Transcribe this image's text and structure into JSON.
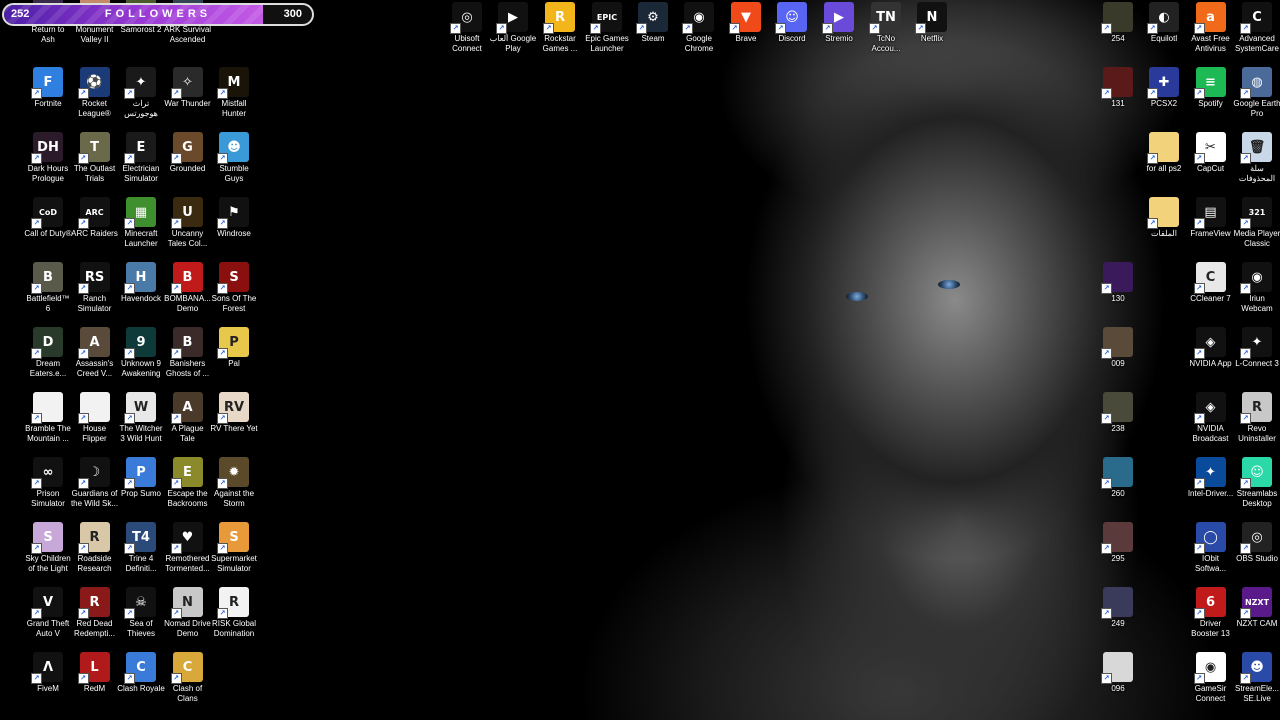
{
  "followers": {
    "current": "252",
    "goal": "300",
    "title": "FOLLOWERS",
    "progress_fraction": 0.84
  },
  "desktop": {
    "icons": [
      {
        "label": "Return to Ash",
        "col": 0,
        "row": 0,
        "color": "#3a2a4a",
        "glyph": "",
        "icon": "game-icon"
      },
      {
        "label": "Monument Valley II",
        "col": 1,
        "row": 0,
        "color": "#c48a6a",
        "glyph": "",
        "icon": "game-icon"
      },
      {
        "label": "Samorost 2",
        "col": 2,
        "row": 0,
        "color": "#4a5a2a",
        "glyph": "",
        "icon": "game-icon"
      },
      {
        "label": "ARK Survival Ascended",
        "col": 3,
        "row": 0,
        "color": "#334455",
        "glyph": "",
        "icon": "game-icon"
      },
      {
        "label": "Fortnite",
        "col": 0,
        "row": 1,
        "color": "#2f7fe0",
        "glyph": "F",
        "icon": "fortnite-icon"
      },
      {
        "label": "Rocket League®",
        "col": 1,
        "row": 1,
        "color": "#1b3a78",
        "glyph": "⚽",
        "icon": "rocket-league-icon"
      },
      {
        "label": "تراث هوجورتس",
        "col": 2,
        "row": 1,
        "color": "#1a1a1a",
        "glyph": "✦",
        "icon": "hogwarts-icon"
      },
      {
        "label": "War Thunder",
        "col": 3,
        "row": 1,
        "color": "#2a2a2a",
        "glyph": "✧",
        "icon": "war-thunder-icon"
      },
      {
        "label": "Mistfall Hunter",
        "col": 4,
        "row": 1,
        "color": "#1a1408",
        "glyph": "M",
        "icon": "game-icon"
      },
      {
        "label": "Dark Hours Prologue",
        "col": 0,
        "row": 2,
        "color": "#2a1a2a",
        "glyph": "DH",
        "icon": "game-icon"
      },
      {
        "label": "The Outlast Trials",
        "col": 1,
        "row": 2,
        "color": "#6a6a4a",
        "glyph": "T",
        "icon": "game-icon"
      },
      {
        "label": "Electrician Simulator",
        "col": 2,
        "row": 2,
        "color": "#1a1a1a",
        "glyph": "E",
        "icon": "game-icon"
      },
      {
        "label": "Grounded",
        "col": 3,
        "row": 2,
        "color": "#6a4a2a",
        "glyph": "G",
        "icon": "game-icon"
      },
      {
        "label": "Stumble Guys",
        "col": 4,
        "row": 2,
        "color": "#3a9ad8",
        "glyph": "☻",
        "icon": "game-icon"
      },
      {
        "label": "Call of Duty®",
        "col": 0,
        "row": 3,
        "color": "#111",
        "glyph": "CoD",
        "icon": "game-icon"
      },
      {
        "label": "ARC Raiders",
        "col": 1,
        "row": 3,
        "color": "#111",
        "glyph": "ARC",
        "icon": "game-icon"
      },
      {
        "label": "Minecraft Launcher",
        "col": 2,
        "row": 3,
        "color": "#3f8f2f",
        "glyph": "▦",
        "icon": "minecraft-icon"
      },
      {
        "label": "Uncanny Tales Col...",
        "col": 3,
        "row": 3,
        "color": "#3a2a10",
        "glyph": "U",
        "icon": "game-icon"
      },
      {
        "label": "Windrose",
        "col": 4,
        "row": 3,
        "color": "#111",
        "glyph": "⚑",
        "icon": "game-icon"
      },
      {
        "label": "Battlefield™ 6",
        "col": 0,
        "row": 4,
        "color": "#5a5a4a",
        "glyph": "B",
        "icon": "game-icon"
      },
      {
        "label": "Ranch Simulator",
        "col": 1,
        "row": 4,
        "color": "#111",
        "glyph": "RS",
        "icon": "game-icon"
      },
      {
        "label": "Havendock",
        "col": 2,
        "row": 4,
        "color": "#4a7aa8",
        "glyph": "H",
        "icon": "game-icon"
      },
      {
        "label": "BOMBANA... Demo",
        "col": 3,
        "row": 4,
        "color": "#c01a1a",
        "glyph": "B",
        "icon": "game-icon"
      },
      {
        "label": "Sons Of The Forest",
        "col": 4,
        "row": 4,
        "color": "#8a1010",
        "glyph": "S",
        "icon": "game-icon"
      },
      {
        "label": "Dream Eaters.e...",
        "col": 0,
        "row": 5,
        "color": "#2a3a2a",
        "glyph": "D",
        "icon": "game-icon"
      },
      {
        "label": "Assassin's Creed V...",
        "col": 1,
        "row": 5,
        "color": "#5a4a3a",
        "glyph": "A",
        "icon": "game-icon"
      },
      {
        "label": "Unknown 9 Awakening",
        "col": 2,
        "row": 5,
        "color": "#0f3a3a",
        "glyph": "9",
        "icon": "game-icon"
      },
      {
        "label": "Banishers Ghosts of ...",
        "col": 3,
        "row": 5,
        "color": "#3a2a2a",
        "glyph": "B",
        "icon": "game-icon"
      },
      {
        "label": "Pal",
        "col": 4,
        "row": 5,
        "color": "#e8c84a",
        "glyph": "P",
        "icon": "game-icon"
      },
      {
        "label": "Bramble The Mountain ...",
        "col": 0,
        "row": 6,
        "color": "#f2f2f2",
        "glyph": "",
        "icon": "file-icon"
      },
      {
        "label": "House Flipper",
        "col": 1,
        "row": 6,
        "color": "#f2f2f2",
        "glyph": "",
        "icon": "file-icon"
      },
      {
        "label": "The Witcher 3 Wild Hunt",
        "col": 2,
        "row": 6,
        "color": "#e8e8e8",
        "glyph": "W",
        "icon": "game-icon"
      },
      {
        "label": "A Plague Tale Requiem - ...",
        "col": 3,
        "row": 6,
        "color": "#4a3a2a",
        "glyph": "A",
        "icon": "game-icon"
      },
      {
        "label": "RV There Yet",
        "col": 4,
        "row": 6,
        "color": "#e8d8c8",
        "glyph": "RV",
        "icon": "game-icon"
      },
      {
        "label": "Prison Simulator",
        "col": 0,
        "row": 7,
        "color": "#111",
        "glyph": "∞",
        "icon": "game-icon"
      },
      {
        "label": "Guardians of the Wild Sk...",
        "col": 1,
        "row": 7,
        "color": "#111",
        "glyph": "☽",
        "icon": "game-icon"
      },
      {
        "label": "Prop Sumo",
        "col": 2,
        "row": 7,
        "color": "#3a7ad8",
        "glyph": "P",
        "icon": "game-icon"
      },
      {
        "label": "Escape the Backrooms",
        "col": 3,
        "row": 7,
        "color": "#8a8a2a",
        "glyph": "E",
        "icon": "game-icon"
      },
      {
        "label": "Against the Storm",
        "col": 4,
        "row": 7,
        "color": "#5a4a2a",
        "glyph": "✹",
        "icon": "game-icon"
      },
      {
        "label": "Sky Children of the Light",
        "col": 0,
        "row": 8,
        "color": "#c8a8d8",
        "glyph": "S",
        "icon": "game-icon"
      },
      {
        "label": "Roadside Research",
        "col": 1,
        "row": 8,
        "color": "#d8c8a8",
        "glyph": "R",
        "icon": "game-icon"
      },
      {
        "label": "Trine 4 Definiti...",
        "col": 2,
        "row": 8,
        "color": "#2a4a7a",
        "glyph": "T4",
        "icon": "game-icon"
      },
      {
        "label": "Remothered Tormented...",
        "col": 3,
        "row": 8,
        "color": "#111",
        "glyph": "♥",
        "icon": "game-icon"
      },
      {
        "label": "Supermarket Simulator",
        "col": 4,
        "row": 8,
        "color": "#e89a3a",
        "glyph": "S",
        "icon": "game-icon"
      },
      {
        "label": "Grand Theft Auto V",
        "col": 0,
        "row": 9,
        "color": "#111",
        "glyph": "V",
        "icon": "gta-icon"
      },
      {
        "label": "Red Dead Redempti...",
        "col": 1,
        "row": 9,
        "color": "#8a1a1a",
        "glyph": "R",
        "icon": "game-icon"
      },
      {
        "label": "Sea of Thieves",
        "col": 2,
        "row": 9,
        "color": "#111",
        "glyph": "☠",
        "icon": "game-icon"
      },
      {
        "label": "Nomad Drive Demo",
        "col": 3,
        "row": 9,
        "color": "#c8c8c8",
        "glyph": "N",
        "icon": "game-icon"
      },
      {
        "label": "RISK Global Domination",
        "col": 4,
        "row": 9,
        "color": "#f2f2f2",
        "glyph": "R",
        "icon": "game-icon"
      },
      {
        "label": "FiveM",
        "col": 0,
        "row": 10,
        "color": "#111",
        "glyph": "Λ",
        "icon": "fivem-icon"
      },
      {
        "label": "RedM",
        "col": 1,
        "row": 10,
        "color": "#b01a1a",
        "glyph": "L",
        "icon": "redm-icon"
      },
      {
        "label": "Clash Royale",
        "col": 2,
        "row": 10,
        "color": "#3a7ad8",
        "glyph": "C",
        "icon": "game-icon"
      },
      {
        "label": "Clash of Clans",
        "col": 3,
        "row": 10,
        "color": "#d8a83a",
        "glyph": "C",
        "icon": "game-icon"
      }
    ],
    "top_icons": [
      {
        "label": "Ubisoft Connect",
        "color": "#111",
        "glyph": "◎",
        "icon": "ubisoft-icon"
      },
      {
        "label": "ألعاب Google Play",
        "color": "#111",
        "glyph": "▶",
        "icon": "google-play-icon"
      },
      {
        "label": "Rockstar Games ...",
        "color": "#f2b61a",
        "glyph": "R",
        "icon": "rockstar-icon"
      },
      {
        "label": "Epic Games Launcher",
        "color": "#111",
        "glyph": "EPIC",
        "icon": "epic-games-icon"
      },
      {
        "label": "Steam",
        "color": "#1b2838",
        "glyph": "⚙",
        "icon": "steam-icon"
      },
      {
        "label": "Google Chrome",
        "color": "#111",
        "glyph": "◉",
        "icon": "chrome-icon"
      },
      {
        "label": "Brave",
        "color": "#f04a1a",
        "glyph": "▼",
        "icon": "brave-icon"
      },
      {
        "label": "Discord",
        "color": "#5865f2",
        "glyph": "☺",
        "icon": "discord-icon"
      },
      {
        "label": "Stremio",
        "color": "#6a4ad8",
        "glyph": "▶",
        "icon": "stremio-icon"
      },
      {
        "label": "TcNo Accou...",
        "color": "#333",
        "glyph": "TN",
        "icon": "tcno-icon"
      },
      {
        "label": "Netflix",
        "color": "#111",
        "glyph": "N",
        "icon": "netflix-icon"
      }
    ],
    "right_icons": [
      {
        "label": "254",
        "col": 0,
        "row": 0,
        "color": "#3a3a2a",
        "glyph": "",
        "icon": "video-icon"
      },
      {
        "label": "Equilotl",
        "col": 1,
        "row": 0,
        "color": "#222",
        "glyph": "◐",
        "icon": "equilotl-icon"
      },
      {
        "label": "Avast Free Antivirus",
        "col": 2,
        "row": 0,
        "color": "#f06a1a",
        "glyph": "a",
        "icon": "avast-icon"
      },
      {
        "label": "Advanced SystemCare",
        "col": 3,
        "row": 0,
        "color": "#111",
        "glyph": "C",
        "icon": "advanced-systemcare-icon"
      },
      {
        "label": "131",
        "col": 0,
        "row": 1,
        "color": "#5a1a1a",
        "glyph": "",
        "icon": "video-icon"
      },
      {
        "label": "PCSX2",
        "col": 1,
        "row": 1,
        "color": "#2a3a9a",
        "glyph": "✚",
        "icon": "pcsx2-icon"
      },
      {
        "label": "Spotify",
        "col": 2,
        "row": 1,
        "color": "#1db954",
        "glyph": "≡",
        "icon": "spotify-icon"
      },
      {
        "label": "Google Earth Pro",
        "col": 3,
        "row": 1,
        "color": "#4a6a9a",
        "glyph": "◍",
        "icon": "google-earth-icon"
      },
      {
        "label": "for all ps2",
        "col": 1,
        "row": 2,
        "color": "#f2d27a",
        "glyph": "",
        "icon": "folder-icon"
      },
      {
        "label": "CapCut",
        "col": 2,
        "row": 2,
        "color": "#fff",
        "glyph": "✂",
        "icon": "capcut-icon"
      },
      {
        "label": "سلة المحذوفات",
        "col": 3,
        "row": 2,
        "color": "#c8d8e8",
        "glyph": "🗑",
        "icon": "recycle-bin-icon"
      },
      {
        "label": "الملفات",
        "col": 1,
        "row": 3,
        "color": "#f2d27a",
        "glyph": "",
        "icon": "folder-icon"
      },
      {
        "label": "FrameView",
        "col": 2,
        "row": 3,
        "color": "#111",
        "glyph": "▤",
        "icon": "frameview-icon"
      },
      {
        "label": "Media Player Classic",
        "col": 3,
        "row": 3,
        "color": "#111",
        "glyph": "321",
        "icon": "media-player-icon"
      },
      {
        "label": "130",
        "col": 0,
        "row": 4,
        "color": "#3a1a5a",
        "glyph": "",
        "icon": "video-icon"
      },
      {
        "label": "CCleaner 7",
        "col": 2,
        "row": 4,
        "color": "#e8e8e8",
        "glyph": "C",
        "icon": "ccleaner-icon"
      },
      {
        "label": "Iriun Webcam",
        "col": 3,
        "row": 4,
        "color": "#111",
        "glyph": "◉",
        "icon": "webcam-icon"
      },
      {
        "label": "009",
        "col": 0,
        "row": 5,
        "color": "#5a4a3a",
        "glyph": "",
        "icon": "video-icon"
      },
      {
        "label": "NVIDIA App",
        "col": 2,
        "row": 5,
        "color": "#111",
        "glyph": "◈",
        "icon": "nvidia-icon"
      },
      {
        "label": "L-Connect 3",
        "col": 3,
        "row": 5,
        "color": "#111",
        "glyph": "✦",
        "icon": "l-connect-icon"
      },
      {
        "label": "238",
        "col": 0,
        "row": 6,
        "color": "#4a4a3a",
        "glyph": "",
        "icon": "video-icon"
      },
      {
        "label": "NVIDIA Broadcast",
        "col": 2,
        "row": 6,
        "color": "#111",
        "glyph": "◈",
        "icon": "nvidia-broadcast-icon"
      },
      {
        "label": "Revo Uninstaller",
        "col": 3,
        "row": 6,
        "color": "#c8c8c8",
        "glyph": "R",
        "icon": "revo-icon"
      },
      {
        "label": "260",
        "col": 0,
        "row": 7,
        "color": "#2a6a8a",
        "glyph": "",
        "icon": "video-icon"
      },
      {
        "label": "Intel-Driver...",
        "col": 2,
        "row": 7,
        "color": "#0a4a9a",
        "glyph": "✦",
        "icon": "intel-icon"
      },
      {
        "label": "Streamlabs Desktop",
        "col": 3,
        "row": 7,
        "color": "#2ad8a8",
        "glyph": "☺",
        "icon": "streamlabs-icon"
      },
      {
        "label": "295",
        "col": 0,
        "row": 8,
        "color": "#5a3a3a",
        "glyph": "",
        "icon": "video-icon"
      },
      {
        "label": "IObit Softwa...",
        "col": 2,
        "row": 8,
        "color": "#2a4aa8",
        "glyph": "◯",
        "icon": "iobit-icon"
      },
      {
        "label": "OBS Studio",
        "col": 3,
        "row": 8,
        "color": "#222",
        "glyph": "◎",
        "icon": "obs-icon"
      },
      {
        "label": "249",
        "col": 0,
        "row": 9,
        "color": "#3a3a5a",
        "glyph": "",
        "icon": "video-icon"
      },
      {
        "label": "Driver Booster 13",
        "col": 2,
        "row": 9,
        "color": "#c01a1a",
        "glyph": "6",
        "icon": "driver-booster-icon"
      },
      {
        "label": "NZXT CAM",
        "col": 3,
        "row": 9,
        "color": "#5a1a8a",
        "glyph": "NZXT",
        "icon": "nzxt-icon"
      },
      {
        "label": "096",
        "col": 0,
        "row": 10,
        "color": "#d8d8d8",
        "glyph": "",
        "icon": "video-icon"
      },
      {
        "label": "GameSir Connect",
        "col": 2,
        "row": 10,
        "color": "#fff",
        "glyph": "◉",
        "icon": "gamesir-icon"
      },
      {
        "label": "StreamEle... SE.Live",
        "col": 3,
        "row": 10,
        "color": "#2a4aa8",
        "glyph": "☻",
        "icon": "streamelements-icon"
      }
    ]
  }
}
